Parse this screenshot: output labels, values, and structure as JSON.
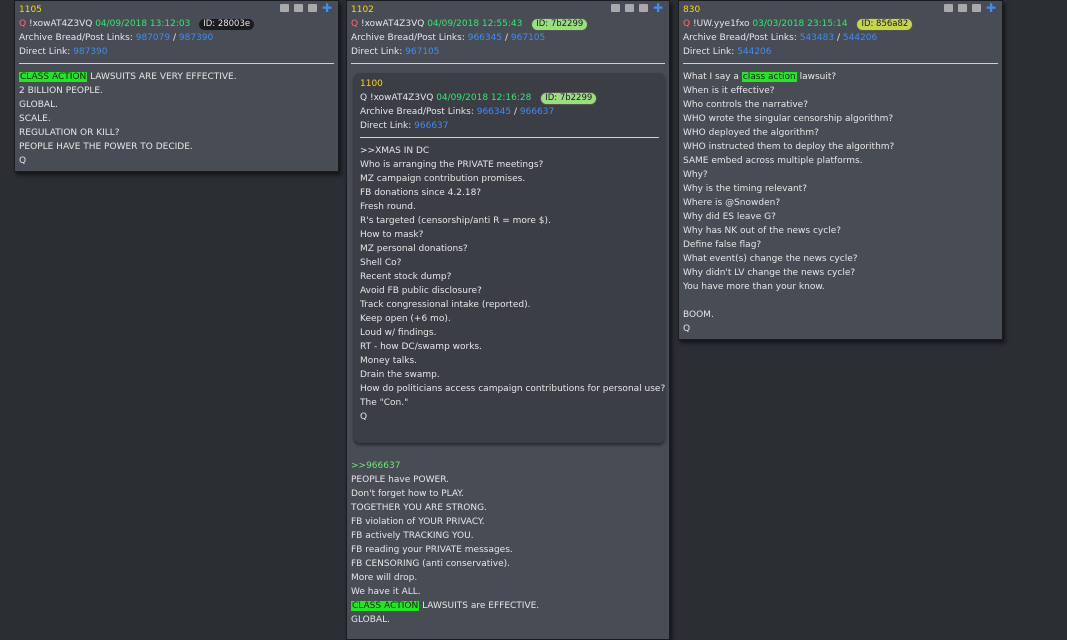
{
  "posts": [
    {
      "num": "1105",
      "q": "Q",
      "trip": "!xowAT4Z3VQ",
      "date": "04/09/2018 13:12:03",
      "id": "ID: 28003e",
      "archive_label": "Archive Bread/Post Links:",
      "archive_a": "987079",
      "archive_sep": "/",
      "archive_b": "987390",
      "direct_label": "Direct Link:",
      "direct": "987390",
      "highlight": "CLASS ACTION",
      "line1_rest": " LAWSUITS ARE VERY EFFECTIVE.",
      "lines": [
        "2 BILLION PEOPLE.",
        "GLOBAL.",
        "SCALE.",
        "REGULATION OR KILL?",
        "PEOPLE HAVE THE POWER TO DECIDE.",
        "Q"
      ]
    },
    {
      "num": "1102",
      "q": "Q",
      "trip": "!xowAT4Z3VQ",
      "date": "04/09/2018 12:55:43",
      "id": "ID: 7b2299",
      "archive_label": "Archive Bread/Post Links:",
      "archive_a": "966345",
      "archive_sep": "/",
      "archive_b": "967105",
      "direct_label": "Direct Link:",
      "direct": "967105",
      "quote": {
        "num": "1100",
        "q": "Q",
        "trip": "!xowAT4Z3VQ",
        "date": "04/09/2018 12:16:28",
        "id": "ID: 7b2299",
        "archive_label": "Archive Bread/Post Links:",
        "archive_a": "966345",
        "archive_sep": "/",
        "archive_b": "966637",
        "direct_label": "Direct Link:",
        "direct": "966637",
        "lines": [
          ">>XMAS IN DC",
          "Who is arranging the PRIVATE meetings?",
          "MZ campaign contribution promises.",
          "FB donations since 4.2.18?",
          "Fresh round.",
          "R's targeted (censorship/anti R = more $).",
          "How to mask?",
          "MZ personal donations?",
          "Shell Co?",
          "Recent stock dump?",
          "Avoid FB public disclosure?",
          "Track congressional intake (reported).",
          "Keep open (+6 mo).",
          "Loud w/ findings.",
          "RT - how DC/swamp works.",
          "Money talks.",
          "Drain the swamp.",
          "How do politicians access campaign contributions for personal use?",
          "The \"Con.\"",
          "Q"
        ]
      },
      "reply_ref": ">>966637",
      "lines": [
        "PEOPLE have POWER.",
        "Don't forget how to PLAY.",
        "TOGETHER YOU ARE STRONG.",
        "FB violation of YOUR PRIVACY.",
        "FB actively TRACKING YOU.",
        "FB reading your PRIVATE messages.",
        "FB CENSORING (anti conservative).",
        "More will drop.",
        "We have it ALL."
      ],
      "highlight": "CLASS ACTION",
      "hl_rest": " LAWSUITS are EFFECTIVE.",
      "after": [
        "GLOBAL."
      ]
    },
    {
      "num": "830",
      "q": "Q",
      "trip": "!UW.yye1fxo",
      "date": "03/03/2018 23:15:14",
      "id": "ID: 856a82",
      "archive_label": "Archive Bread/Post Links:",
      "archive_a": "543483",
      "archive_sep": "/",
      "archive_b": "544206",
      "direct_label": "Direct Link:",
      "direct": "544206",
      "line1_pre": "What I say a ",
      "highlight": "class action",
      "line1_rest": " lawsuit?",
      "lines": [
        "When is it effective?",
        "Who controls the narrative?",
        "WHO wrote the singular censorship algorithm?",
        "WHO deployed the algorithm?",
        "WHO instructed them to deploy the algorithm?",
        "SAME embed across multiple platforms.",
        "Why?",
        "Why is the timing relevant?",
        "Where is @Snowden?",
        "Why did ES leave G?",
        "Why has NK out of the news cycle?",
        "Define false flag?",
        "What event(s) change the news cycle?",
        "Why didn't LV change the news cycle?",
        "You have more than your know.",
        "",
        "BOOM.",
        "Q"
      ]
    }
  ]
}
